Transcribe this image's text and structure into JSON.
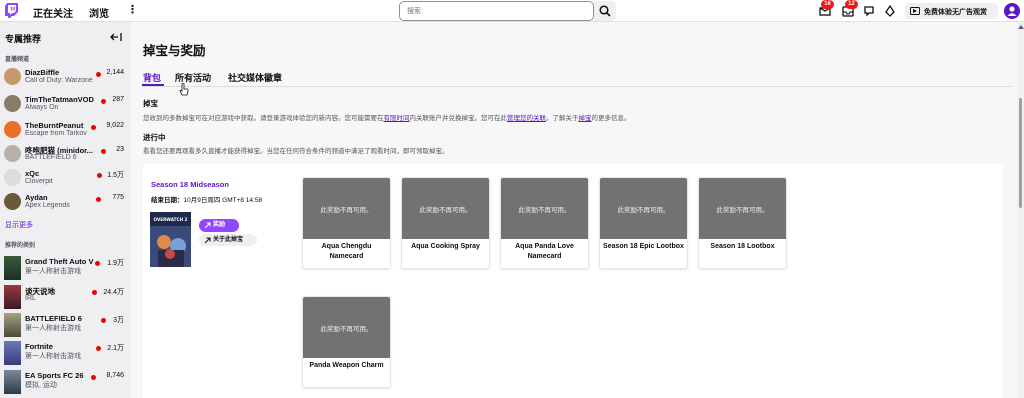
{
  "nav": {
    "following": "正在关注",
    "browse": "浏览",
    "search_placeholder": "搜索",
    "badges": [
      "16",
      "12"
    ],
    "turbo_label": "免费体验无广告观赏",
    "colors": {
      "brand": "#9147ff",
      "accent": "#5c16c5",
      "live": "#eb0400"
    }
  },
  "sidebar": {
    "title": "专属推荐",
    "live_label": "直播频道",
    "show_more": "显示更多",
    "categories_label": "推荐的类别",
    "channels": [
      {
        "name": "DiazBiffle",
        "game": "Call of Duty: Warzone",
        "viewers": "2,144"
      },
      {
        "name": "TimTheTatmanVOD",
        "game": "Always On",
        "viewers": "287"
      },
      {
        "name": "TheBurntPeanut",
        "game": "Escape from Tarkov",
        "viewers": "9,022"
      },
      {
        "name": "咚咆肥猫 (minidor...",
        "game": "BATTLEFIELD 6",
        "viewers": "23"
      },
      {
        "name": "xQc",
        "game": "Cloverpit",
        "viewers": "1.5万"
      },
      {
        "name": "Aydan",
        "game": "Apex Legends",
        "viewers": "775"
      }
    ],
    "categories": [
      {
        "name": "Grand Theft Auto V",
        "tag": "第一人称射击游戏",
        "viewers": "1.9万"
      },
      {
        "name": "谈天说地",
        "tag": "IRL",
        "viewers": "24.4万"
      },
      {
        "name": "BATTLEFIELD 6",
        "tag": "第一人称射击游戏",
        "viewers": "3万"
      },
      {
        "name": "Fortnite",
        "tag": "第一人称射击游戏",
        "viewers": "2.1万"
      },
      {
        "name": "EA Sports FC 26",
        "tag": "模拟, 运动",
        "viewers": "8,746"
      }
    ]
  },
  "main": {
    "title": "掉宝与奖励",
    "tabs": [
      "背包",
      "所有活动",
      "社交媒体徽章"
    ],
    "drops_heading": "掉宝",
    "drops_text_1": "您收到的多数掉宝可在对应游戏中获取。请登录游戏体验您的新内容。您可能需要在",
    "drops_link_1": "有限时间",
    "drops_text_2": "内关联账户并兑换掉宝。您可在此",
    "drops_link_2": "管理您的关联",
    "drops_text_3": "。了解关于",
    "drops_link_3": "掉宝",
    "drops_text_4": "的更多信息。",
    "progress_heading": "进行中",
    "progress_text": "看看您还要再观看多久直播才能获得掉宝。当您在任何符合条件的频道中满足了观看时间，即可领取掉宝。"
  },
  "campaign": {
    "name": "Season 18 Midseason",
    "end_label": "结束日期：",
    "end_value": "10月9日周四 GMT+8 14:58",
    "art_text": "OVERWATCH 2",
    "drops_button": "奖励",
    "about_button": "关于此掉宝",
    "unavailable_text": "此奖励不再可用。",
    "rewards": [
      "Aqua Chengdu Namecard",
      "Aqua Cooking Spray",
      "Aqua Panda Love Namecard",
      "Season 18 Epic Lootbox",
      "Season 18 Lootbox",
      "Panda Weapon Charm"
    ]
  }
}
